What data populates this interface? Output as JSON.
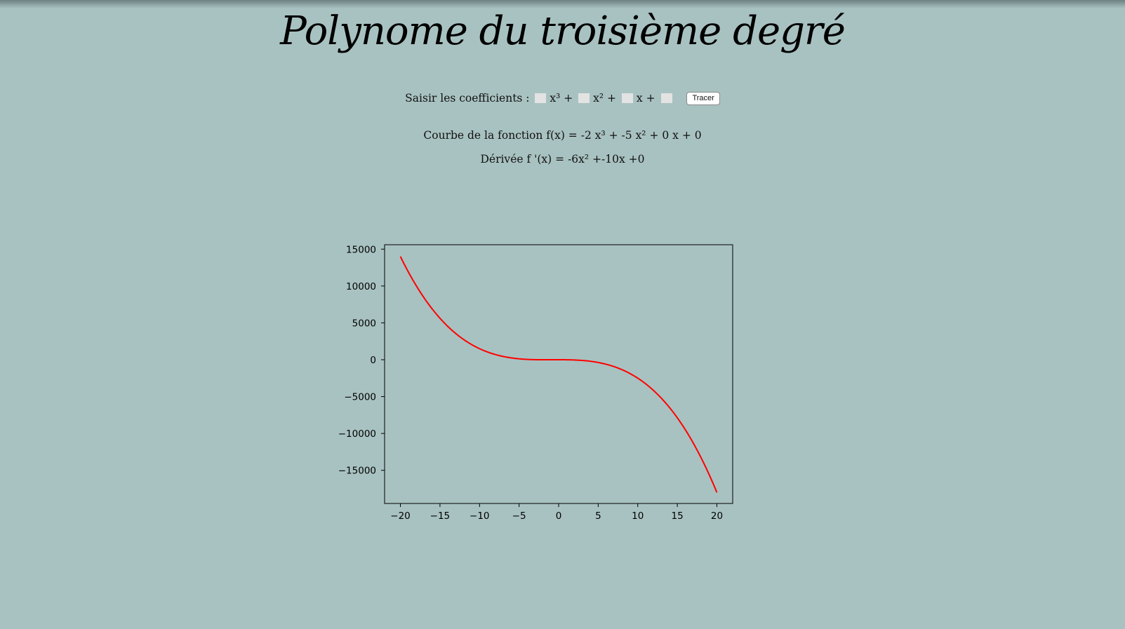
{
  "header": {
    "title": "Polynome du troisième degré"
  },
  "form": {
    "prompt": "Saisir les coefficients :",
    "term_x3": "x³ +",
    "term_x2": "x² +",
    "term_x": "x +",
    "inputs": [
      "",
      "",
      "",
      ""
    ],
    "button_label": "Tracer"
  },
  "results": {
    "curve_label": "Courbe de la fonction f(x) = -2 x³ + -5 x² + 0 x + 0",
    "derivative_label": "Dérivée f '(x) = -6x² +-10x +0"
  },
  "chart_data": {
    "type": "line",
    "function": {
      "a": -2,
      "b": -5,
      "c": 0,
      "d": 0
    },
    "xlim": [
      -22,
      22
    ],
    "ylim": [
      -19500,
      15600
    ],
    "x_domain": [
      -20,
      20
    ],
    "x_ticks": [
      -20,
      -15,
      -10,
      -5,
      0,
      5,
      10,
      15,
      20
    ],
    "x_tick_labels": [
      "−20",
      "−15",
      "−10",
      "−5",
      "0",
      "5",
      "10",
      "15",
      "20"
    ],
    "y_ticks": [
      15000,
      10000,
      5000,
      0,
      -5000,
      -10000,
      -15000
    ],
    "y_tick_labels": [
      "15000",
      "10000",
      "5000",
      "0",
      "−5000",
      "−10000",
      "−15000"
    ],
    "series": [
      {
        "x": [
          -20,
          -15,
          -10,
          -5,
          0,
          5,
          10,
          15,
          20
        ],
        "y": [
          14000,
          5625,
          1500,
          125,
          0,
          -375,
          -2500,
          -7875,
          -18000
        ],
        "color": "#ff0000"
      }
    ],
    "grid": false,
    "title": "",
    "xlabel": "",
    "ylabel": ""
  }
}
